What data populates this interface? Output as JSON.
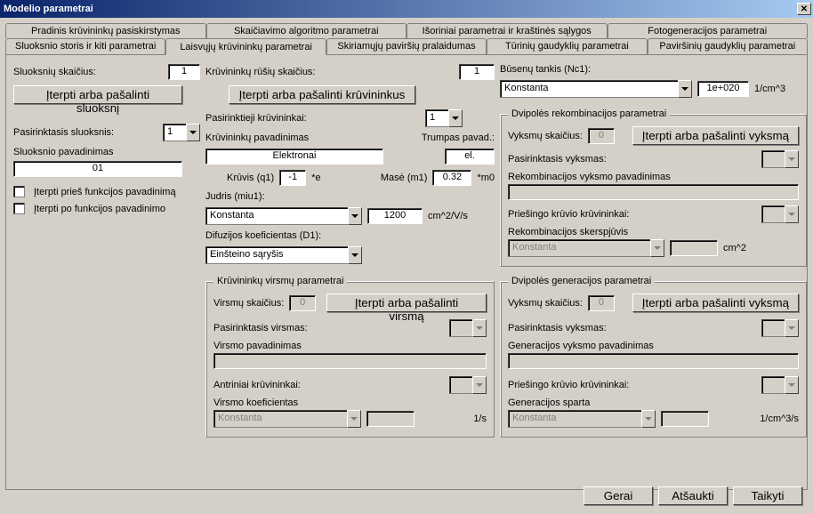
{
  "title": "Modelio parametrai",
  "tabsRow1": {
    "t1": "Pradinis krūvininkų pasiskirstymas",
    "t2": "Skaičiavimo algoritmo parametrai",
    "t3": "Išoriniai parametrai ir kraštinės sąlygos",
    "t4": "Fotogeneracijos parametrai"
  },
  "tabsRow2": {
    "t1": "Sluoksnio storis ir kiti parametrai",
    "t2": "Laisvųjų krūvininkų parametrai",
    "t3": "Skiriamųjų paviršių pralaidumas",
    "t4": "Tūrinių gaudyklių parametrai",
    "t5": "Paviršinių gaudyklių parametrai"
  },
  "left": {
    "layerCountLabel": "Sluoksnių skaičius:",
    "layerCount": "1",
    "insertLayerBtn": "Įterpti arba pašalinti sluoksnį",
    "selectedLayerLabel": "Pasirinktasis sluoksnis:",
    "selectedLayer": "1",
    "layerNameLabel": "Sluoksnio pavadinimas",
    "layerName": "01",
    "cb1": "Įterpti prieš funkcijos pavadinimą",
    "cb2": "Įterpti po funkcijos pavadinimo"
  },
  "mid": {
    "typesLabel": "Krūvininkų rūšių skaičius:",
    "typesCount": "1",
    "insertCarrierBtn": "Įterpti arba pašalinti krūvininkus",
    "selCarriersLabel": "Pasirinktieji krūvininkai:",
    "selCarriers": "1",
    "carrierNameLabel": "Krūvininkų pavadinimas",
    "shortNameLabel": "Trumpas pavad.:",
    "carrierName": "Elektronai",
    "shortName": "el.",
    "chargeLabel": "Krūvis (q1)",
    "charge": "-1",
    "chargeUnit": "*e",
    "massLabel": "Masė (m1)",
    "mass": "0.32",
    "massUnit": "*m0",
    "mobilityLabel": "Judris (miu1):",
    "mobilitySel": "Konstanta",
    "mobilityVal": "1200",
    "mobilityUnit": "cm^2/V/s",
    "diffLabel": "Difuzijos koeficientas (D1):",
    "diffSel": "Einšteino sąryšis"
  },
  "right": {
    "densityLabel": "Būsenų tankis (Nc1):",
    "densitySel": "Konstanta",
    "densityVal": "1e+020",
    "densityUnit": "1/cm^3"
  },
  "transGroup": {
    "legend": "Krūvininkų virsmų parametrai",
    "countLabel": "Virsmų skaičius:",
    "count": "0",
    "btn": "Įterpti arba pašalinti virsmą",
    "selLabel": "Pasirinktasis virsmas:",
    "nameLabel": "Virsmo pavadinimas",
    "secLabel": "Antriniai krūvininkai:",
    "coefLabel": "Virsmo koeficientas",
    "coefSel": "Konstanta",
    "coefUnit": "1/s"
  },
  "recombGroup": {
    "legend": "Dvipolės rekombinacijos parametrai",
    "countLabel": "Vyksmų skaičius:",
    "count": "0",
    "btn": "Įterpti arba pašalinti vyksmą",
    "selLabel": "Pasirinktasis vyksmas:",
    "nameLabel": "Rekombinacijos vyksmo pavadinimas",
    "oppLabel": "Priešingo krūvio krūvininkai:",
    "csLabel": "Rekombinacijos skerspjūvis",
    "csSel": "Konstanta",
    "csUnit": "cm^2"
  },
  "genGroup": {
    "legend": "Dvipolės generacijos parametrai",
    "countLabel": "Vyksmų skaičius:",
    "count": "0",
    "btn": "Įterpti arba pašalinti vyksmą",
    "selLabel": "Pasirinktasis vyksmas:",
    "nameLabel": "Generacijos vyksmo pavadinimas",
    "oppLabel": "Priešingo krūvio krūvininkai:",
    "rateLabel": "Generacijos sparta",
    "rateSel": "Konstanta",
    "rateUnit": "1/cm^3/s"
  },
  "buttons": {
    "ok": "Gerai",
    "cancel": "Atšaukti",
    "apply": "Taikyti"
  }
}
